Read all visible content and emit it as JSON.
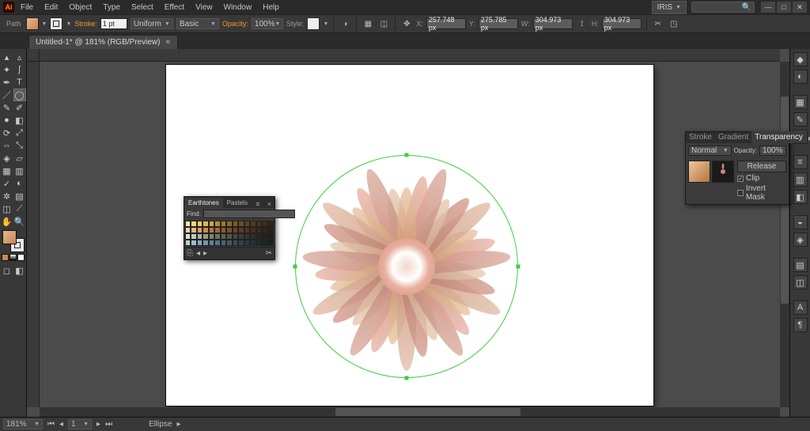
{
  "app": {
    "logo": "Ai"
  },
  "menu": [
    "File",
    "Edit",
    "Object",
    "Type",
    "Select",
    "Effect",
    "View",
    "Window",
    "Help"
  ],
  "workspace": {
    "label": "IRIS"
  },
  "control": {
    "path_label": "Path",
    "stroke_label": "Stroke:",
    "stroke_pt": "1 pt",
    "profile": "Uniform",
    "brush": "Basic",
    "opacity_label": "Opacity:",
    "opacity": "100%",
    "style_label": "Style:",
    "x_label": "X:",
    "x": "257.748 px",
    "y_label": "Y:",
    "y": "275.785 px",
    "w_label": "W:",
    "w": "304.973 px",
    "h_label": "H:",
    "h": "304.973 px"
  },
  "tab": {
    "title": "Untitled-1* @ 181% (RGB/Preview)"
  },
  "swatch_panel": {
    "tabs": [
      "Earthtones",
      "Pastels"
    ],
    "find_label": "Find:",
    "colors": [
      "#f6e7b3",
      "#efd77f",
      "#e7c964",
      "#dcb84a",
      "#caa63f",
      "#b68f35",
      "#9f7a2d",
      "#8a6a29",
      "#7b5c24",
      "#6c5020",
      "#5d451e",
      "#523d1c",
      "#47351a",
      "#3d2e18",
      "#342716",
      "#f0d0a8",
      "#e3b787",
      "#d6a06a",
      "#c68b53",
      "#b67842",
      "#a26838",
      "#8e5a31",
      "#7c4e2b",
      "#6c4326",
      "#5e3a22",
      "#53331f",
      "#492d1c",
      "#3f2819",
      "#362216",
      "#2e1d14",
      "#d7e0d2",
      "#bfc9b7",
      "#a8b39e",
      "#919d87",
      "#7b8772",
      "#6b7563",
      "#5c6555",
      "#4f5749",
      "#434a3e",
      "#3a4036",
      "#32372f",
      "#2b3029",
      "#252924",
      "#20231f",
      "#1b1e1b",
      "#b7cfd8",
      "#9fbcc7",
      "#88a9b6",
      "#7397a5",
      "#608594",
      "#547585",
      "#496676",
      "#405967",
      "#384d59",
      "#31424c",
      "#2b3941",
      "#263137",
      "#212a2f",
      "#1d2428",
      "#191f22"
    ]
  },
  "transparency": {
    "tabs": [
      "Stroke",
      "Gradient",
      "Transparency"
    ],
    "mode": "Normal",
    "opacity_label": "Opacity:",
    "opacity": "100%",
    "release": "Release",
    "clip": "Clip",
    "invert": "Invert Mask"
  },
  "status": {
    "zoom": "181%",
    "tool": "Ellipse"
  }
}
